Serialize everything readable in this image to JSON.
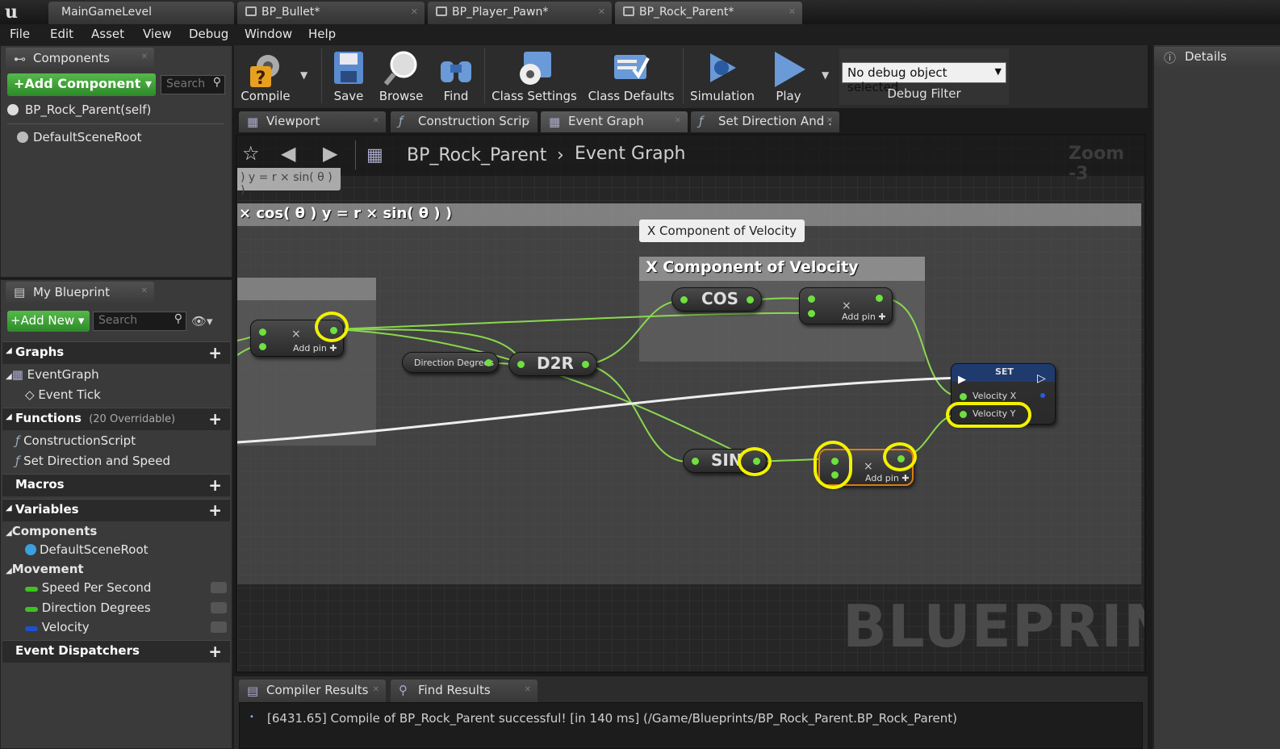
{
  "app": {
    "logo": "u"
  },
  "doc_tabs": [
    {
      "label": "MainGameLevel"
    },
    {
      "label": "BP_Bullet*"
    },
    {
      "label": "BP_Player_Pawn*"
    },
    {
      "label": "BP_Rock_Parent*"
    }
  ],
  "menu": [
    "File",
    "Edit",
    "Asset",
    "View",
    "Debug",
    "Window",
    "Help"
  ],
  "components_panel": {
    "tab": "Components",
    "add_button": "+Add Component",
    "search_placeholder": "Search",
    "items": [
      "BP_Rock_Parent(self)",
      "DefaultSceneRoot"
    ]
  },
  "my_blueprint": {
    "tab": "My Blueprint",
    "add_button": "+Add New",
    "search_placeholder": "Search",
    "graphs_header": "Graphs",
    "event_graph": "EventGraph",
    "event_tick": "Event Tick",
    "functions_header": "Functions",
    "functions_note": "(20 Overridable)",
    "functions": [
      "ConstructionScript",
      "Set Direction and Speed"
    ],
    "macros_header": "Macros",
    "variables_header": "Variables",
    "components_sub": "Components",
    "default_scene_root": "DefaultSceneRoot",
    "movement_sub": "Movement",
    "vars": [
      {
        "name": "Speed Per Second",
        "color": "#3ec31e"
      },
      {
        "name": "Direction Degrees",
        "color": "#3ec31e"
      },
      {
        "name": "Velocity",
        "color": "#1d4fcf"
      }
    ],
    "event_dispatchers_header": "Event Dispatchers"
  },
  "toolbar": {
    "compile": "Compile",
    "save": "Save",
    "browse": "Browse",
    "find": "Find",
    "class_settings": "Class Settings",
    "class_defaults": "Class Defaults",
    "simulation": "Simulation",
    "play": "Play",
    "debug_select": "No debug object selected",
    "debug_filter": "Debug Filter"
  },
  "graph_tabs": [
    {
      "label": "Viewport"
    },
    {
      "label": "Construction Scrip"
    },
    {
      "label": "Event Graph"
    },
    {
      "label": "Set Direction And :"
    }
  ],
  "details": {
    "tab": "Details"
  },
  "graph": {
    "breadcrumb_root": "BP_Rock_Parent",
    "breadcrumb_leaf": "Event Graph",
    "zoom": "Zoom -3",
    "formula_small": ") y = r × sin( θ ) )",
    "formula_header": "× cos( θ ) y = r × sin( θ ) )",
    "tooltip": "X Component of Velocity",
    "comment_title": "X Component of Velocity",
    "cos": "COS",
    "sin": "SIN",
    "d2r": "D2R",
    "direction_degrees": "Direction Degrees",
    "add_pin": "Add pin",
    "multiply_symbol": "×",
    "set_title": "SET",
    "velocity_x": "Velocity X",
    "velocity_y": "Velocity Y",
    "watermark": "BLUEPRINT"
  },
  "bottom": {
    "tabs": [
      "Compiler Results",
      "Find Results"
    ],
    "message": "[6431.65] Compile of BP_Rock_Parent successful! [in 140 ms] (/Game/Blueprints/BP_Rock_Parent.BP_Rock_Parent)"
  }
}
